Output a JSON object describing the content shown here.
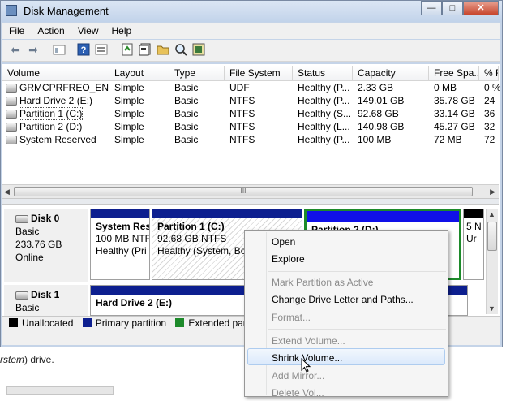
{
  "window": {
    "title": "Disk Management",
    "buttons": {
      "minimize": "—",
      "maximize": "□",
      "close": "✕"
    }
  },
  "menubar": [
    "File",
    "Action",
    "View",
    "Help"
  ],
  "toolbar": [
    "back-icon",
    "forward-icon",
    "up-icon",
    "help-icon",
    "properties-icon",
    "refresh-icon",
    "properties-sheet-icon",
    "open-icon",
    "find-icon",
    "settings-icon"
  ],
  "volume_table": {
    "columns": [
      "Volume",
      "Layout",
      "Type",
      "File System",
      "Status",
      "Capacity",
      "Free Spa...",
      "% F"
    ],
    "rows": [
      {
        "volume": "GRMCPRFREO_EN...",
        "layout": "Simple",
        "type": "Basic",
        "fs": "UDF",
        "status": "Healthy (P...",
        "capacity": "2.33 GB",
        "free": "0 MB",
        "pct": "0 %"
      },
      {
        "volume": "Hard Drive 2 (E:)",
        "layout": "Simple",
        "type": "Basic",
        "fs": "NTFS",
        "status": "Healthy (P...",
        "capacity": "149.01 GB",
        "free": "35.78 GB",
        "pct": "24"
      },
      {
        "volume": "Partition 1 (C:)",
        "layout": "Simple",
        "type": "Basic",
        "fs": "NTFS",
        "status": "Healthy (S...",
        "capacity": "92.68 GB",
        "free": "33.14 GB",
        "pct": "36"
      },
      {
        "volume": "Partition 2 (D:)",
        "layout": "Simple",
        "type": "Basic",
        "fs": "NTFS",
        "status": "Healthy (L...",
        "capacity": "140.98 GB",
        "free": "45.27 GB",
        "pct": "32"
      },
      {
        "volume": "System Reserved",
        "layout": "Simple",
        "type": "Basic",
        "fs": "NTFS",
        "status": "Healthy (P...",
        "capacity": "100 MB",
        "free": "72 MB",
        "pct": "72"
      }
    ],
    "hscroll_grip": "III"
  },
  "disks": [
    {
      "name": "Disk 0",
      "type": "Basic",
      "size": "233.76 GB",
      "status": "Online",
      "partitions": [
        {
          "name": "System Res",
          "line2": "100 MB NTF",
          "line3": "Healthy (Pri"
        },
        {
          "name": "Partition 1  (C:)",
          "line2": "92.68 GB NTFS",
          "line3": "Healthy (System, Boo"
        },
        {
          "name": "Partition 2  (D:)",
          "line2": "",
          "line3": ""
        },
        {
          "name": "",
          "line2": "5 N",
          "line3": "Ur"
        }
      ]
    },
    {
      "name": "Disk 1",
      "type": "Basic",
      "size": "",
      "status": "",
      "partitions": [
        {
          "name": "Hard Drive 2  (E:)",
          "line2": "",
          "line3": ""
        }
      ]
    }
  ],
  "legend": [
    {
      "label": "Unallocated",
      "color": "#000000"
    },
    {
      "label": "Primary partition",
      "color": "#0d1f8f"
    },
    {
      "label": "Extended partiti",
      "color": "#1d8a2a"
    }
  ],
  "context_menu": {
    "items": [
      {
        "label": "Open",
        "enabled": true
      },
      {
        "label": "Explore",
        "enabled": true
      },
      {
        "label": "Mark Partition as Active",
        "enabled": false
      },
      {
        "label": "Change Drive Letter and Paths...",
        "enabled": true
      },
      {
        "label": "Format...",
        "enabled": false
      },
      {
        "label": "Extend Volume...",
        "enabled": false
      },
      {
        "label": "Shrink Volume...",
        "enabled": true,
        "highlighted": true
      },
      {
        "label": "Add Mirror...",
        "enabled": false
      },
      {
        "label": "Delete Vol...",
        "enabled": false
      }
    ]
  },
  "background_text": {
    "italic": "rstem",
    "rest": ") drive."
  }
}
